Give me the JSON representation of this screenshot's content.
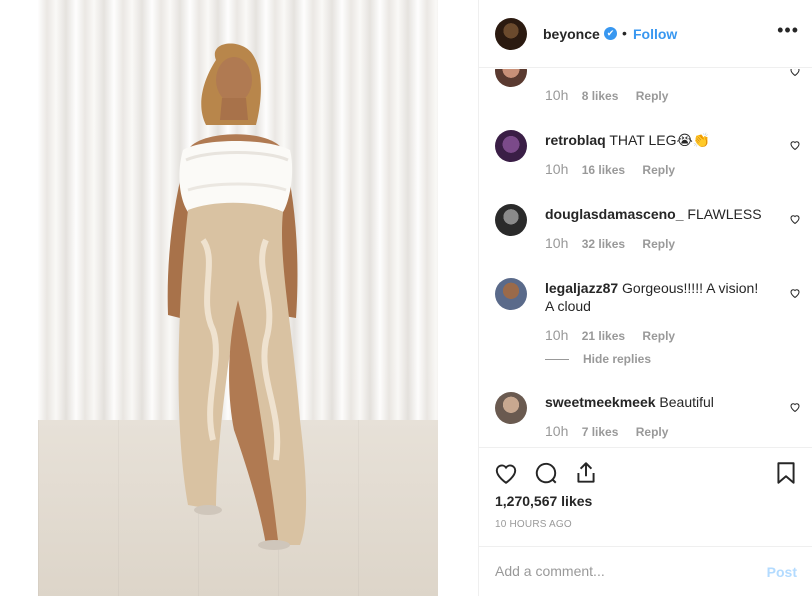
{
  "post": {
    "username": "beyonce",
    "verified_glyph": "✔",
    "separator": "•",
    "follow_label": "Follow",
    "more_label": "•••",
    "photo_icon": "photo-image",
    "likes": "1,270,567 likes",
    "time_ago": "10 HOURS AGO"
  },
  "comments": [
    {
      "user": "",
      "text": "",
      "time": "10h",
      "likes": "8 likes",
      "reply": "Reply"
    },
    {
      "user": "retroblaq",
      "text": " THAT LEG😭👏",
      "time": "10h",
      "likes": "16 likes",
      "reply": "Reply"
    },
    {
      "user": "douglasdamasceno_",
      "text": " FLAWLESS",
      "time": "10h",
      "likes": "32 likes",
      "reply": "Reply"
    },
    {
      "user": "legaljazz87",
      "text": " Gorgeous!!!!! A vision! A cloud",
      "time": "10h",
      "likes": "21 likes",
      "reply": "Reply",
      "hide_replies": "Hide replies"
    },
    {
      "user": "sweetmeekmeek",
      "text": " Beautiful",
      "time": "10h",
      "likes": "7 likes",
      "reply": "Reply"
    }
  ],
  "add_comment": {
    "placeholder": "Add a comment...",
    "post_label": "Post"
  },
  "colors": {
    "link_blue": "#3897f0",
    "post_disabled": "#b3dbff",
    "muted": "#999999",
    "text": "#262626"
  }
}
